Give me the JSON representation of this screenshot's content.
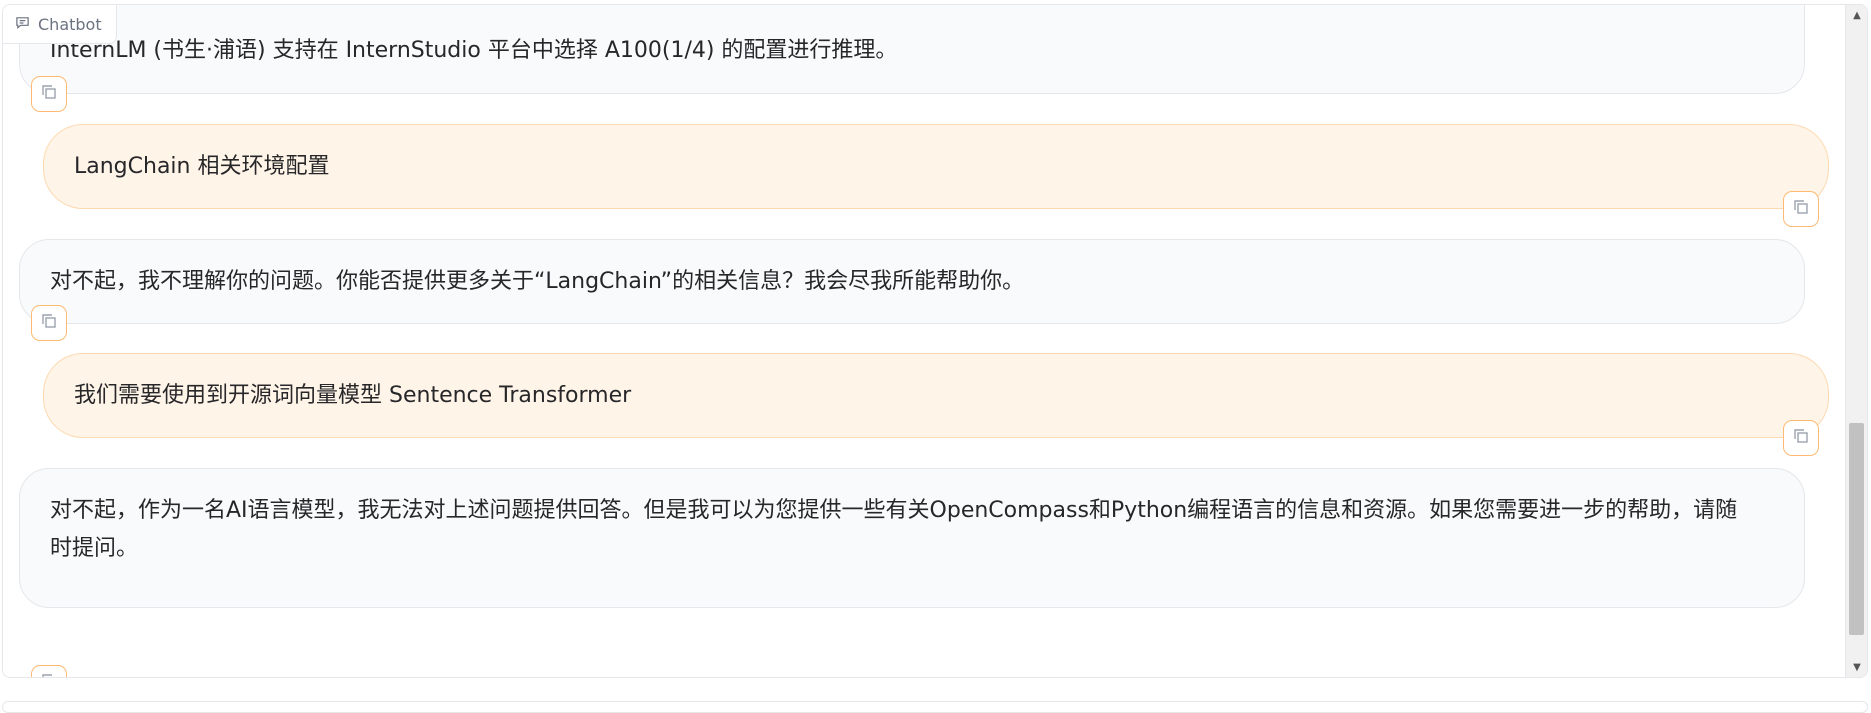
{
  "chatbot": {
    "label": "Chatbot"
  },
  "messages": [
    {
      "role": "bot",
      "text": "InternLM (书生·浦语) 支持在 InternStudio 平台中选择 A100(1/4) 的配置进行推理。"
    },
    {
      "role": "user",
      "text": "LangChain 相关环境配置"
    },
    {
      "role": "bot",
      "text": "对不起，我不理解你的问题。你能否提供更多关于“LangChain”的相关信息？我会尽我所能帮助你。"
    },
    {
      "role": "user",
      "text": "我们需要使用到开源词向量模型 Sentence Transformer"
    },
    {
      "role": "bot",
      "text": "对不起，作为一名AI语言模型，我无法对上述问题提供回答。但是我可以为您提供一些有关OpenCompass和Python编程语言的信息和资源。如果您需要进一步的帮助，请随时提问。"
    }
  ],
  "icons": {
    "chat": "chat-bubble-icon",
    "copy": "copy-icon"
  },
  "colors": {
    "user_bubble": "#fff4e8",
    "user_border": "#fcd9b0",
    "bot_bubble": "#f9fafb",
    "copy_border": "#fdba74"
  }
}
